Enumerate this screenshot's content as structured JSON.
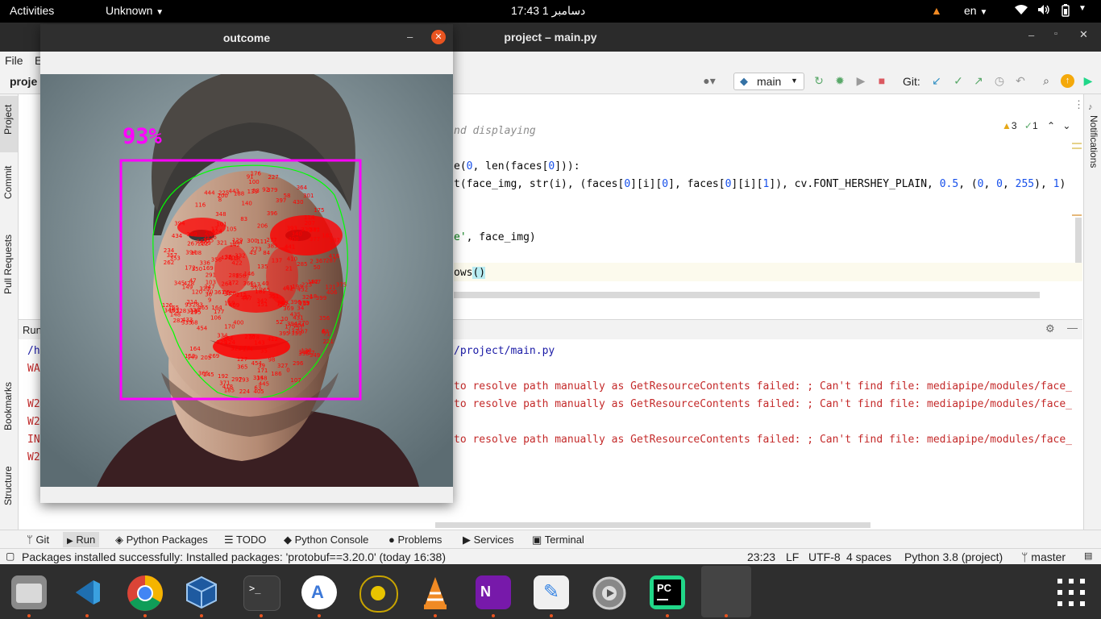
{
  "topbar": {
    "activities": "Activities",
    "app_menu": "Unknown",
    "clock": "17:43  1 دسامبر",
    "lang": "en"
  },
  "window": {
    "title": "project – main.py"
  },
  "menu": {
    "file": "File",
    "edit": "E"
  },
  "toolbar": {
    "project_crumb": "proje",
    "run_config": "main",
    "git_label": "Git:"
  },
  "sidebar_left": {
    "project": "Project",
    "commit": "Commit",
    "pull_requests": "Pull Requests",
    "bookmarks": "Bookmarks",
    "structure": "Structure"
  },
  "sidebar_right": {
    "notifications": "Notifications"
  },
  "editor": {
    "inspection_warnings": "3",
    "inspection_weak": "1",
    "lines": {
      "l1": "nd displaying",
      "l2a": "e(",
      "l2b": "0",
      "l2c": ", len(faces[",
      "l2d": "0",
      "l2e": "])):",
      "l3a": "t(face_img, str(i), (faces[",
      "l3b": "0",
      "l3c": "][i][",
      "l3d": "0",
      "l3e": "], faces[",
      "l3f": "0",
      "l3g": "][i][",
      "l3h": "1",
      "l3i": "]), cv.FONT_HERSHEY_PLAIN, ",
      "l3j": "0.5",
      "l3k": ", (",
      "l3l": "0",
      "l3m": ", ",
      "l3n": "0",
      "l3o": ", ",
      "l3p": "255",
      "l3q": "), ",
      "l3r": "1",
      "l3s": ")",
      "l4a": "e'",
      "l4b": ", face_img)",
      "l5a": "ows",
      "l5b": "()"
    }
  },
  "run": {
    "tab_label": "Run",
    "left_fragments": [
      "/h",
      "WA",
      "W2",
      "W2",
      "IN",
      "W2"
    ],
    "line_path": "/project/main.py",
    "line_error": "to resolve path manually as GetResourceContents failed: ; Can't find file: mediapipe/modules/face_"
  },
  "tool_tabs": [
    "Git",
    "Run",
    "Python Packages",
    "TODO",
    "Python Console",
    "Problems",
    "Services",
    "Terminal"
  ],
  "status": {
    "message": "Packages installed successfully: Installed packages: 'protobuf==3.20.0' (today 16:38)",
    "position": "23:23",
    "line_sep": "LF",
    "encoding": "UTF-8",
    "indent": "4 spaces",
    "interpreter": "Python 3.8 (project)",
    "branch": "master"
  },
  "outcome": {
    "title": "outcome",
    "confidence": "93%",
    "landmark_numbers": [
      "149",
      "10",
      "338",
      "67",
      "109",
      "297",
      "332",
      "103",
      "104",
      "108",
      "151",
      "337",
      "333",
      "21",
      "68",
      "105",
      "107",
      "9",
      "336",
      "296",
      "334",
      "71",
      "63",
      "70",
      "46",
      "53",
      "52",
      "65",
      "55",
      "8",
      "285",
      "295",
      "282",
      "283",
      "276",
      "300",
      "293",
      "301",
      "162",
      "139",
      "156",
      "124",
      "35",
      "225",
      "224",
      "223",
      "222",
      "221",
      "193",
      "168",
      "417",
      "441",
      "442",
      "443",
      "444",
      "445",
      "342",
      "265",
      "353",
      "383",
      "372",
      "127",
      "34",
      "143",
      "111",
      "117",
      "118",
      "119",
      "120",
      "121",
      "128",
      "245",
      "188",
      "174",
      "6",
      "351",
      "412",
      "399",
      "465",
      "357",
      "350",
      "349",
      "348",
      "347",
      "346",
      "340",
      "345",
      "227",
      "234",
      "116",
      "123",
      "50",
      "101",
      "100",
      "47",
      "114",
      "217",
      "126",
      "142",
      "129",
      "98",
      "97",
      "2",
      "326",
      "327",
      "358",
      "371",
      "355",
      "277",
      "329",
      "330",
      "280",
      "347",
      "454",
      "447",
      "356",
      "93",
      "137",
      "177",
      "215",
      "138",
      "135",
      "169",
      "170",
      "140",
      "171",
      "175",
      "152",
      "396",
      "369",
      "395",
      "394",
      "378",
      "400",
      "377",
      "379",
      "365",
      "397",
      "367",
      "364",
      "394",
      "132",
      "58",
      "172",
      "136",
      "150",
      "149",
      "176",
      "148",
      "377",
      "400",
      "378",
      "379",
      "365",
      "397",
      "288",
      "361",
      "323",
      "454",
      "356",
      "389",
      "264",
      "447",
      "366",
      "401",
      "435",
      "433",
      "416",
      "367",
      "364",
      "430",
      "434",
      "432",
      "422",
      "424",
      "418",
      "421",
      "200",
      "199",
      "175",
      "396",
      "428",
      "262",
      "431",
      "369",
      "395",
      "394",
      "204",
      "192",
      "214",
      "207",
      "205",
      "36",
      "206",
      "203",
      "165",
      "167",
      "164",
      "92",
      "186",
      "57",
      "43",
      "106",
      "182",
      "83",
      "18",
      "313",
      "406",
      "335",
      "273",
      "287",
      "410",
      "322",
      "391",
      "393",
      "164",
      "0",
      "267",
      "269",
      "270",
      "409",
      "291",
      "375",
      "321",
      "405",
      "314",
      "17",
      "84",
      "181",
      "91",
      "146",
      "61",
      "185",
      "40",
      "39",
      "37"
    ],
    "colors": {
      "box": "#ff00ff",
      "landmark_text": "#ff0000",
      "contour": "#00ff00"
    }
  }
}
